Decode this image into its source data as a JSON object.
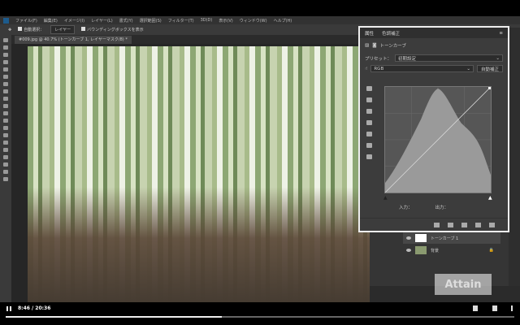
{
  "menu": [
    "ファイル(F)",
    "編集(E)",
    "イメージ(I)",
    "レイヤー(L)",
    "書式(Y)",
    "選択範囲(S)",
    "フィルター(T)",
    "3D(D)",
    "表示(V)",
    "ウィンドウ(W)",
    "ヘルプ(H)"
  ],
  "options": {
    "auto_select": "自動選択：",
    "layer_select": "レイヤー",
    "bounding_box": "バウンディングボックスを表示"
  },
  "doc_tab": "#009.jpg @ 40.7% (トーンカーブ 1, レイヤーマスク/8) *",
  "properties": {
    "tab_active": "属性",
    "tab_other": "色調補正",
    "title": "トーンカーブ",
    "preset_label": "プリセット：",
    "preset_value": "初期設定",
    "channel": "RGB",
    "auto_button": "自動補正",
    "input_label": "入力：",
    "output_label": "出力："
  },
  "layers": [
    {
      "name": "トーンカーブ 1"
    },
    {
      "name": "背景"
    }
  ],
  "watermark": "Attain",
  "player": {
    "time": "8:46 / 20:36",
    "progress_percent": 42.5
  }
}
